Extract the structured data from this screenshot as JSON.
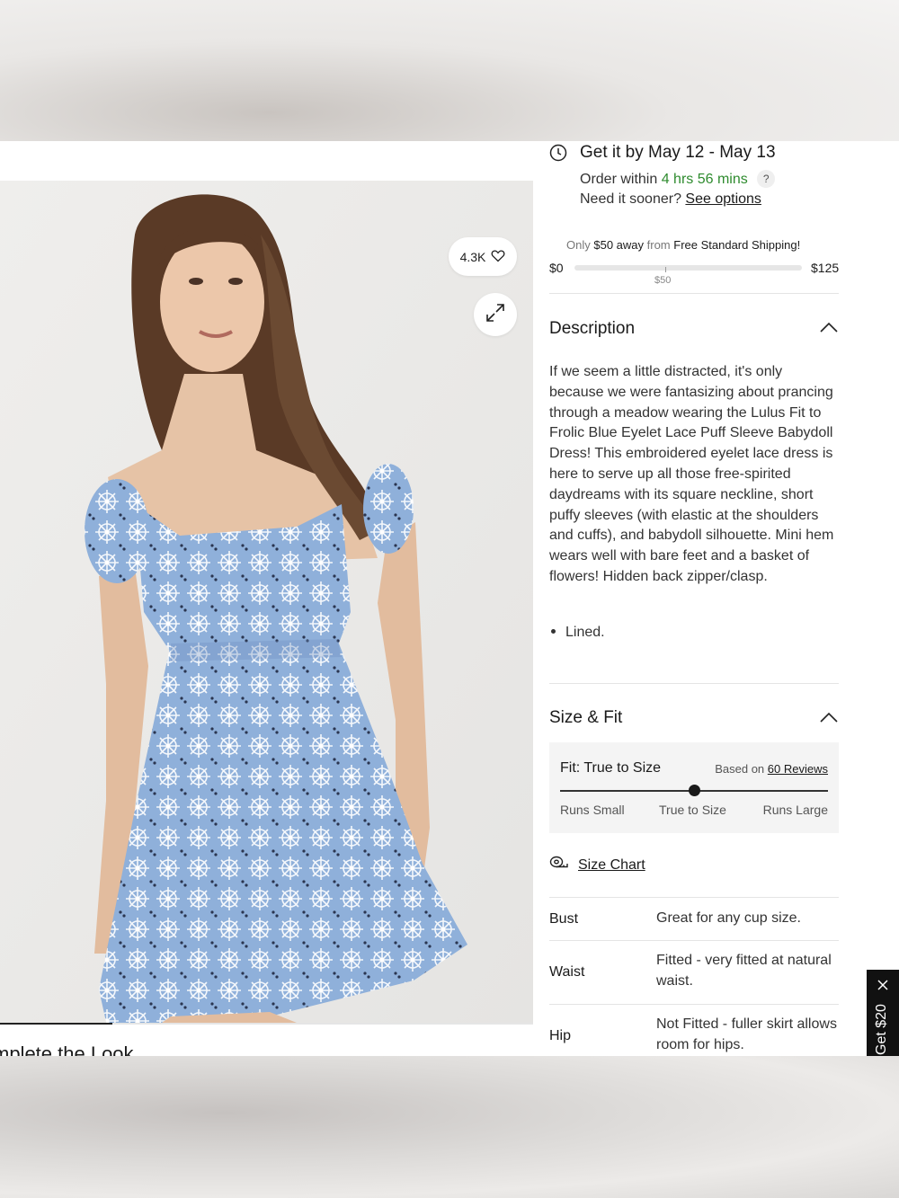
{
  "gallery": {
    "like_count": "4.3K",
    "complete_the_look": "mplete the Look",
    "image_progress": 0.21
  },
  "delivery": {
    "title": "Get it by May 12 - May 13",
    "order_prefix": "Order within",
    "order_time": "4 hrs 56 mins",
    "help_glyph": "?",
    "need_sooner": "Need it sooner?",
    "see_options": "See options"
  },
  "shipping": {
    "only": "Only",
    "amount_away": "$50 away",
    "from": "from",
    "target": "Free Standard Shipping!",
    "min_label": "$0",
    "max_label": "$125",
    "mid_label": "$50",
    "progress": 0.4
  },
  "description": {
    "title": "Description",
    "body": "If we seem a little distracted, it's only because we were fantasizing about prancing through a meadow wearing the Lulus Fit to Frolic Blue Eyelet Lace Puff Sleeve Babydoll Dress! This embroidered eyelet lace dress is here to serve up all those free-spirited daydreams with its square neckline, short puffy sleeves (with elastic at the shoulders and cuffs), and babydoll silhouette. Mini hem wears well with bare feet and a basket of flowers! Hidden back zipper/clasp.",
    "bullet": "Lined."
  },
  "size_fit": {
    "title": "Size & Fit",
    "fit_label": "Fit: True to Size",
    "based_on": "Based on",
    "reviews_link": "60 Reviews",
    "scale_small": "Runs Small",
    "scale_true": "True to Size",
    "scale_large": "Runs Large",
    "fit_position": 0.5,
    "size_chart": "Size Chart",
    "specs": [
      {
        "label": "Bust",
        "value": "Great for any cup size."
      },
      {
        "label": "Waist",
        "value": "Fitted - very fitted at natural waist."
      },
      {
        "label": "Hip",
        "value": "Not Fitted - fuller skirt allows room for hips."
      }
    ]
  },
  "promo": {
    "text": "Get $20"
  },
  "colors": {
    "accent_green": "#2e8b2e",
    "dress_blue": "#8fb0da",
    "promo_bg": "#111111"
  },
  "icons": [
    "clock-icon",
    "heart-icon",
    "expand-icon",
    "chevron-up-icon",
    "ruler-icon",
    "close-icon"
  ]
}
